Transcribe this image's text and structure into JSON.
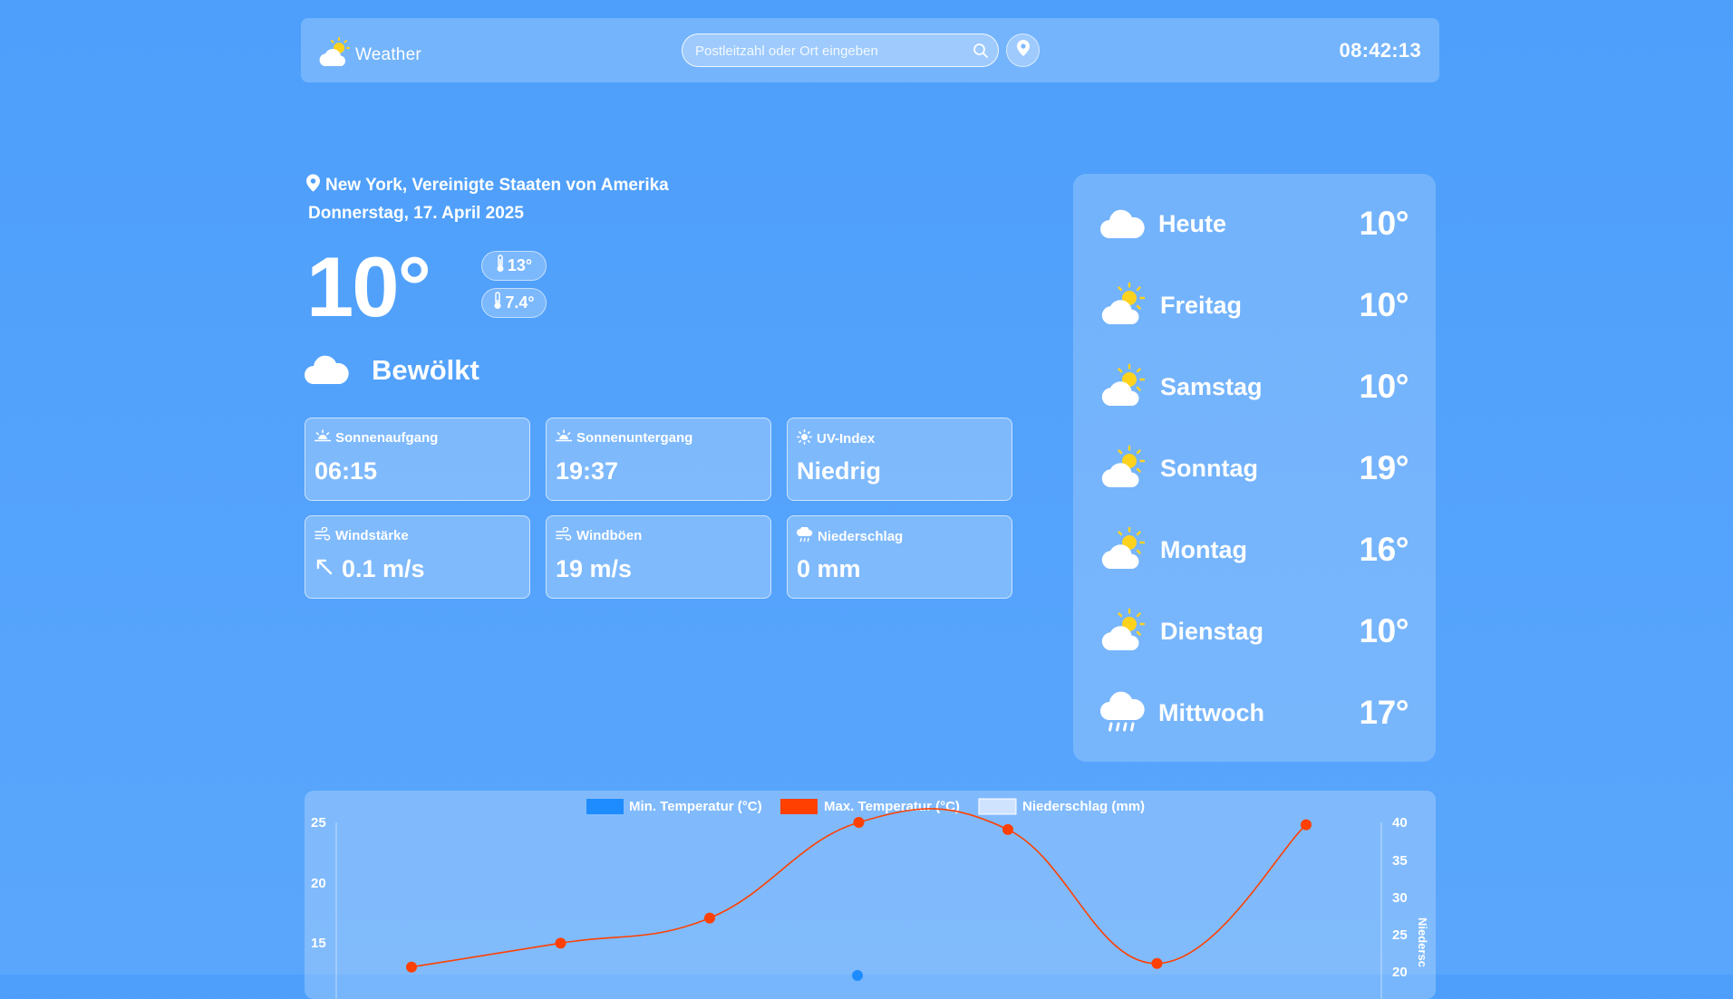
{
  "header": {
    "brand": "Weather",
    "search_placeholder": "Postleitzahl oder Ort eingeben",
    "time": "08:42:13"
  },
  "current": {
    "location": "New York, Vereinigte Staaten von Amerika",
    "date": "Donnerstag, 17. April 2025",
    "temp": "10°",
    "temp_max": "13°",
    "temp_min": "7.4°",
    "condition": "Bewölkt",
    "condition_icon": "cloud-icon"
  },
  "details": [
    {
      "label": "Sonnenaufgang",
      "value": "06:15",
      "icon": "sunrise-icon"
    },
    {
      "label": "Sonnenuntergang",
      "value": "19:37",
      "icon": "sunset-icon"
    },
    {
      "label": "UV-Index",
      "value": "Niedrig",
      "icon": "sun-icon"
    },
    {
      "label": "Windstärke",
      "value": "0.1 m/s",
      "icon": "wind-icon",
      "arrow_icon": "wind-direction-arrow-icon"
    },
    {
      "label": "Windböen",
      "value": "19 m/s",
      "icon": "wind-icon"
    },
    {
      "label": "Niederschlag",
      "value": "0 mm",
      "icon": "rain-icon"
    }
  ],
  "forecast": [
    {
      "day": "Heute",
      "temp": "10°",
      "icon": "cloud-icon"
    },
    {
      "day": "Freitag",
      "temp": "10°",
      "icon": "partly-cloudy-icon"
    },
    {
      "day": "Samstag",
      "temp": "10°",
      "icon": "partly-cloudy-icon"
    },
    {
      "day": "Sonntag",
      "temp": "19°",
      "icon": "partly-cloudy-icon"
    },
    {
      "day": "Montag",
      "temp": "16°",
      "icon": "partly-cloudy-icon"
    },
    {
      "day": "Dienstag",
      "temp": "10°",
      "icon": "partly-cloudy-icon"
    },
    {
      "day": "Mittwoch",
      "temp": "17°",
      "icon": "rain-icon"
    }
  ],
  "colors": {
    "background": "#4d9ffb",
    "min_temp": "#1e8cff",
    "max_temp": "#ff4000",
    "precip": "#cfe3ff",
    "sun": "#ffd21e"
  },
  "chart_data": {
    "type": "line",
    "legend": [
      {
        "name": "Min. Temperatur (°C)",
        "color": "#1e8cff"
      },
      {
        "name": "Max. Temperatur (°C)",
        "color": "#ff4000"
      },
      {
        "name": "Niederschlag (mm)",
        "color": "#cfe3ff"
      }
    ],
    "series": [
      {
        "name": "Max. Temperatur (°C)",
        "values": [
          12.9,
          14.9,
          17.0,
          25.0,
          24.4,
          13.2,
          24.8
        ]
      }
    ],
    "y_left": {
      "ticks": [
        "25",
        "20",
        "15"
      ]
    },
    "y_right": {
      "label": "Niedersc",
      "ticks": [
        "40",
        "35",
        "30",
        "25",
        "20"
      ]
    }
  }
}
